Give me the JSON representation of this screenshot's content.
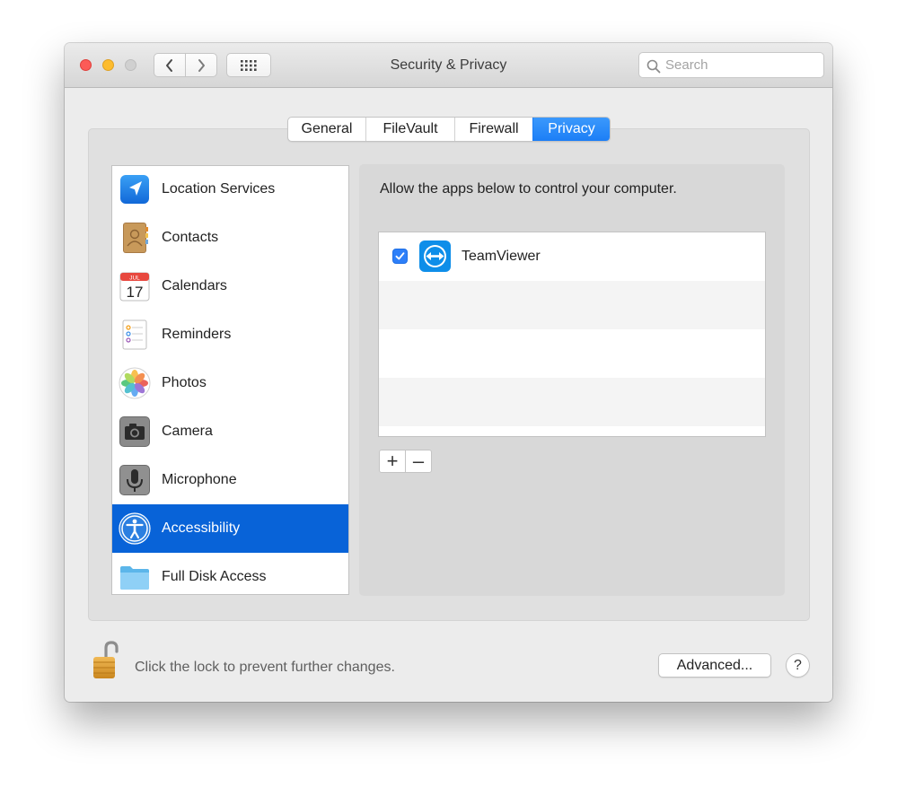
{
  "window": {
    "title": "Security & Privacy",
    "search": {
      "placeholder": "Search",
      "value": ""
    }
  },
  "tabs": [
    {
      "label": "General",
      "selected": false
    },
    {
      "label": "FileVault",
      "selected": false
    },
    {
      "label": "Firewall",
      "selected": false
    },
    {
      "label": "Privacy",
      "selected": true
    }
  ],
  "sidebar": {
    "items": [
      {
        "label": "Location Services",
        "icon": "location-arrow-icon"
      },
      {
        "label": "Contacts",
        "icon": "contacts-book-icon"
      },
      {
        "label": "Calendars",
        "icon": "calendar-icon",
        "icon_month": "JUL",
        "icon_day": "17"
      },
      {
        "label": "Reminders",
        "icon": "reminders-icon"
      },
      {
        "label": "Photos",
        "icon": "photos-flower-icon"
      },
      {
        "label": "Camera",
        "icon": "camera-icon"
      },
      {
        "label": "Microphone",
        "icon": "microphone-icon"
      },
      {
        "label": "Accessibility",
        "icon": "accessibility-icon",
        "selected": true
      },
      {
        "label": "Full Disk Access",
        "icon": "folder-icon"
      }
    ]
  },
  "main": {
    "description": "Allow the apps below to control your computer.",
    "apps": [
      {
        "name": "TeamViewer",
        "checked": true,
        "icon": "teamviewer-icon"
      }
    ],
    "add_button": "+",
    "remove_button": "–"
  },
  "footer": {
    "lock_text": "Click the lock to prevent further changes.",
    "lock_state": "unlocked",
    "advanced_button": "Advanced...",
    "help_button": "?"
  },
  "colors": {
    "selection": "#0863d8",
    "tab_active": "#1c7ef6",
    "checkbox": "#2d7ff9",
    "close": "#fc5b57",
    "minimize": "#fdbc2e",
    "zoom_disabled": "#d0d0d0"
  }
}
